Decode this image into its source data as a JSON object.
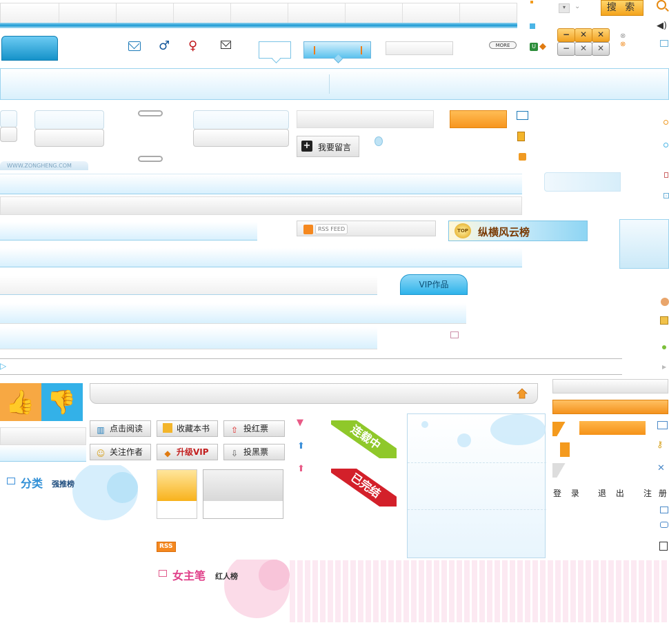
{
  "header": {
    "search_label": "搜 索",
    "more_label": "MORE"
  },
  "site": {
    "watermark": "WWW.ZONGHENG.COM"
  },
  "buttons": {
    "leave_message": "我要留言",
    "rss_feed": "RSS FEED",
    "rss": "RSS",
    "vip_works": "VIP作品"
  },
  "ranking": {
    "title": "纵横风云榜",
    "badge": "TOP"
  },
  "book_actions": {
    "read": "点击阅读",
    "collect": "收藏本书",
    "red_vote": "投红票",
    "follow_author": "关注作者",
    "upgrade_vip": "升级VIP",
    "black_vote": "投黑票"
  },
  "status": {
    "ongoing": "连载中",
    "completed": "已完结"
  },
  "sections": {
    "category_title": "分类",
    "category_sub": "强推榜",
    "female_title": "女主笔",
    "female_sub": "红人榜"
  },
  "auth": {
    "login": "登 录",
    "logout": "退 出",
    "register": "注 册"
  },
  "window_controls": {
    "minimize": "−",
    "close": "✕",
    "close2": "✕"
  },
  "icons": {
    "accent": "#1592c9",
    "orange": "#f7951e"
  }
}
